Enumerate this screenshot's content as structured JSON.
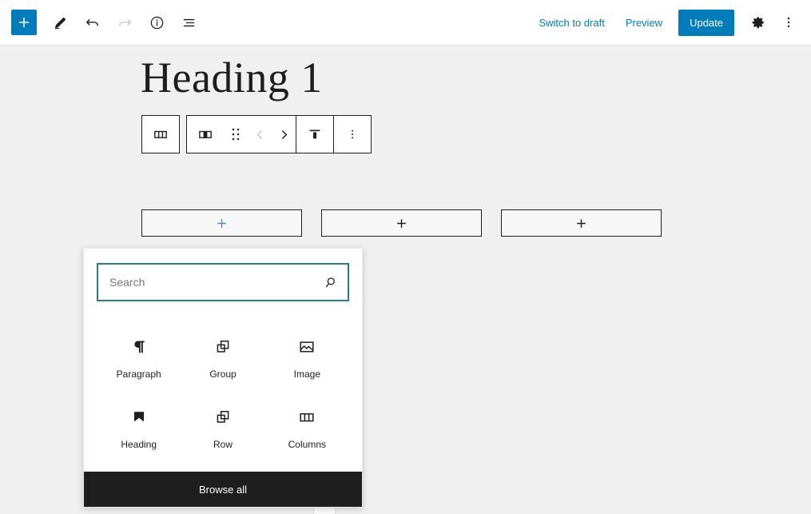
{
  "header": {
    "left_tools": [
      {
        "name": "add-block",
        "icon": "plus-icon",
        "label": "Toggle block inserter",
        "primary": true
      },
      {
        "name": "tools",
        "icon": "pencil-icon",
        "label": "Tools",
        "primary": false
      },
      {
        "name": "undo",
        "icon": "undo-icon",
        "label": "Undo",
        "primary": false
      },
      {
        "name": "redo",
        "icon": "redo-icon",
        "label": "Redo",
        "primary": false,
        "disabled": true
      },
      {
        "name": "details",
        "icon": "info-icon",
        "label": "Details",
        "primary": false
      },
      {
        "name": "list-view",
        "icon": "list-view-icon",
        "label": "List View",
        "primary": false
      }
    ],
    "switch_to_draft_label": "Switch to draft",
    "preview_label": "Preview",
    "update_label": "Update",
    "settings_icon_label": "Settings",
    "options_icon_label": "Options"
  },
  "canvas": {
    "heading_text": "Heading 1"
  },
  "block_toolbar": {
    "parent_button_label": "Select parent block: Columns",
    "items": [
      {
        "name": "block-type-column",
        "icon": "column-block-icon",
        "label": "Column"
      },
      {
        "name": "drag-handle",
        "icon": "drag-dots-icon",
        "label": "Drag"
      },
      {
        "name": "move-left",
        "icon": "chevron-left-icon",
        "label": "Move left",
        "disabled": true
      },
      {
        "name": "move-right",
        "icon": "chevron-right-icon",
        "label": "Move right",
        "disabled": false
      },
      {
        "name": "vertical-align",
        "icon": "align-top-icon",
        "label": "Change vertical alignment"
      },
      {
        "name": "more-options",
        "icon": "kebab-icon",
        "label": "Options"
      }
    ]
  },
  "columns": [
    {
      "name": "column-appender-1",
      "icon": "plus-icon",
      "accent": true
    },
    {
      "name": "column-appender-2",
      "icon": "plus-icon",
      "accent": false
    },
    {
      "name": "column-appender-3",
      "icon": "plus-icon",
      "accent": false
    }
  ],
  "inserter": {
    "search": {
      "value": "",
      "placeholder": "Search",
      "icon": "search-icon"
    },
    "blocks": [
      {
        "label": "Paragraph",
        "icon": "paragraph-icon"
      },
      {
        "label": "Group",
        "icon": "group-icon"
      },
      {
        "label": "Image",
        "icon": "image-icon"
      },
      {
        "label": "Heading",
        "icon": "heading-icon"
      },
      {
        "label": "Row",
        "icon": "row-icon"
      },
      {
        "label": "Columns",
        "icon": "columns-icon"
      }
    ],
    "browse_all_label": "Browse all"
  },
  "colors": {
    "accent": "#007cba",
    "focus_border": "#2b7b8c",
    "appender_accent": "#4b92ab",
    "dark": "#1e1e1e",
    "canvas_bg": "#f0f0f0"
  }
}
